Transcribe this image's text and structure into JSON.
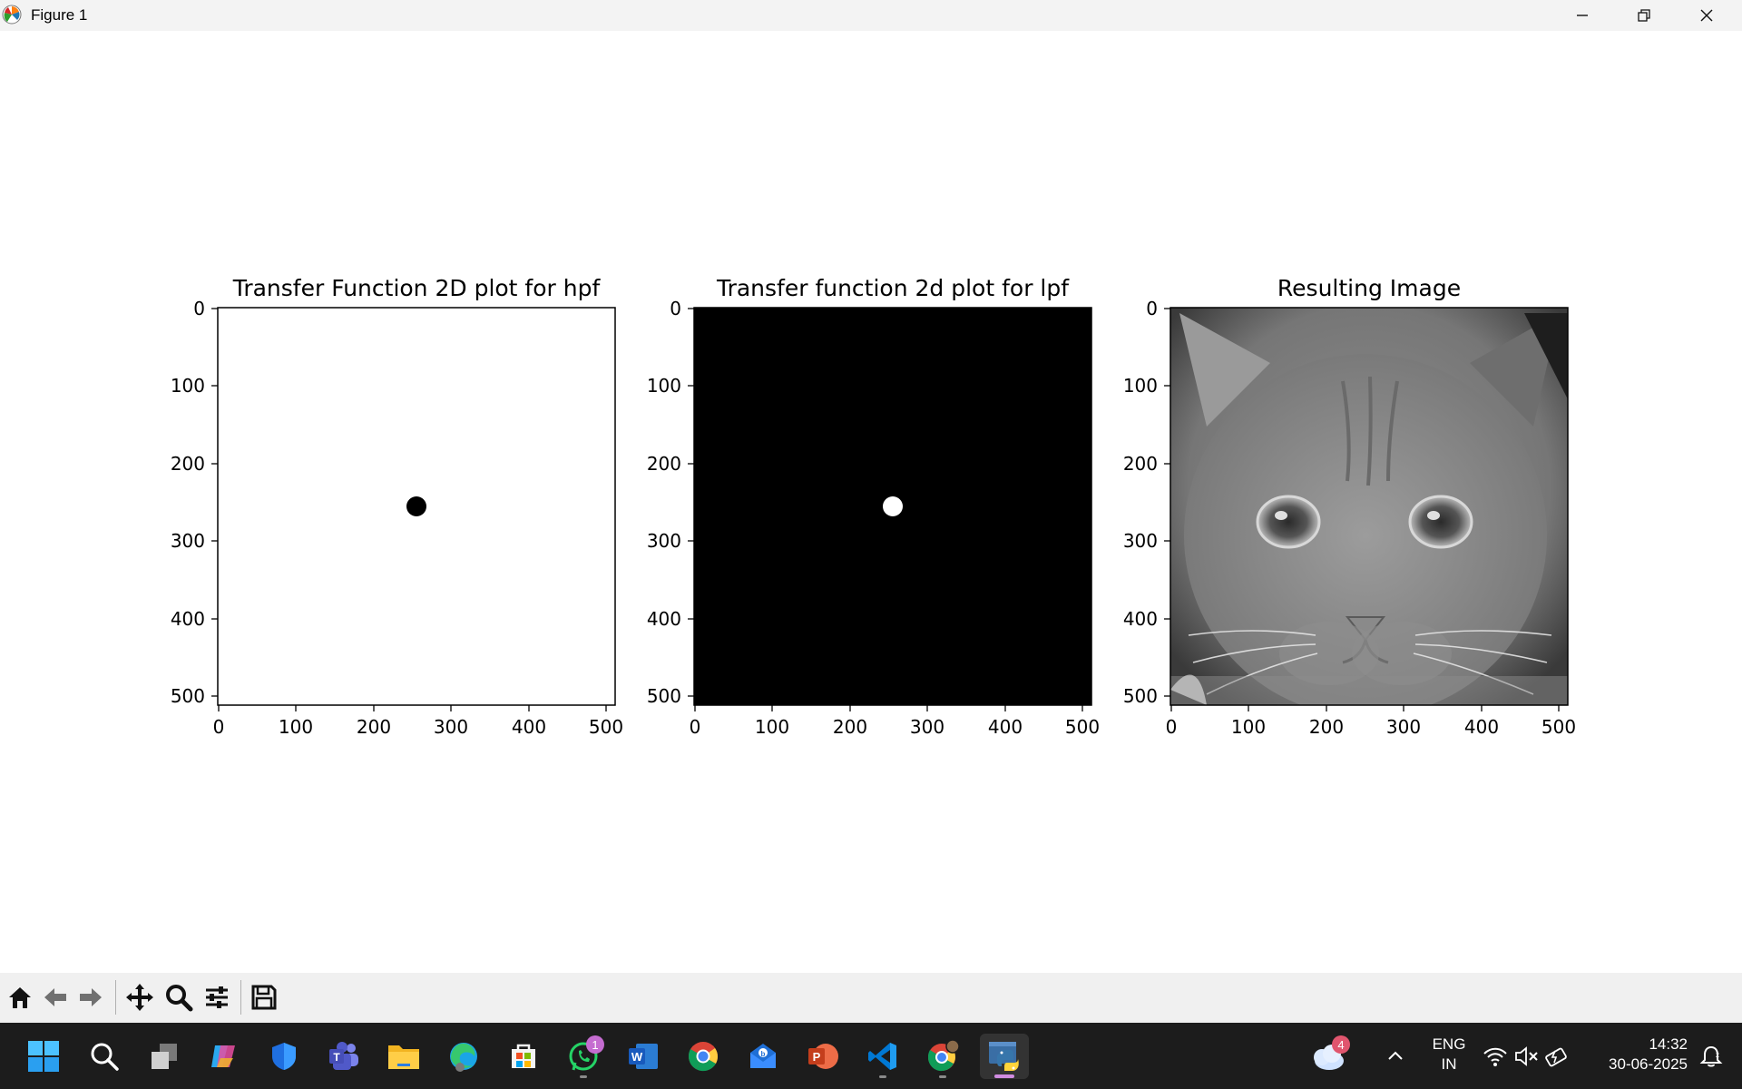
{
  "window": {
    "title": "Figure 1",
    "icons": [
      "matplotlib-icon",
      "minimize-icon",
      "restore-icon",
      "close-icon"
    ]
  },
  "figure": {
    "panels": [
      {
        "title": "Transfer Function 2D plot for hpf",
        "content": "white field with small black disk at center",
        "background": "#ffffff",
        "disk_color": "#000000",
        "x_ticks": [
          "0",
          "100",
          "200",
          "300",
          "400",
          "500"
        ],
        "y_ticks": [
          "0",
          "100",
          "200",
          "300",
          "400",
          "500"
        ]
      },
      {
        "title": "Transfer function 2d plot for lpf",
        "content": "black field with small white disk at center",
        "background": "#000000",
        "disk_color": "#ffffff",
        "x_ticks": [
          "0",
          "100",
          "200",
          "300",
          "400",
          "500"
        ],
        "y_ticks": [
          "0",
          "100",
          "200",
          "300",
          "400",
          "500"
        ]
      },
      {
        "title": "Resulting Image",
        "content": "grayscale filtered photo of a kitten",
        "x_ticks": [
          "0",
          "100",
          "200",
          "300",
          "400",
          "500"
        ],
        "y_ticks": [
          "0",
          "100",
          "200",
          "300",
          "400",
          "500"
        ]
      }
    ]
  },
  "toolbar": {
    "icons": [
      "home-icon",
      "back-icon",
      "forward-icon",
      "pan-icon",
      "zoom-icon",
      "configure-subplots-icon",
      "save-icon"
    ]
  },
  "taskbar": {
    "apps": [
      {
        "name": "start",
        "icon": "windows-start-icon"
      },
      {
        "name": "search",
        "icon": "search-icon"
      },
      {
        "name": "task-view",
        "icon": "task-view-icon"
      },
      {
        "name": "copilot",
        "icon": "copilot-icon"
      },
      {
        "name": "defender",
        "icon": "shield-icon"
      },
      {
        "name": "teams",
        "icon": "teams-icon"
      },
      {
        "name": "file-explorer",
        "icon": "folder-icon"
      },
      {
        "name": "edge",
        "icon": "edge-icon"
      },
      {
        "name": "store",
        "icon": "store-icon"
      },
      {
        "name": "whatsapp",
        "icon": "whatsapp-icon",
        "badge": "1"
      },
      {
        "name": "word",
        "icon": "word-icon"
      },
      {
        "name": "chrome",
        "icon": "chrome-icon"
      },
      {
        "name": "mail",
        "icon": "mail-icon"
      },
      {
        "name": "powerpoint",
        "icon": "powerpoint-icon"
      },
      {
        "name": "vscode",
        "icon": "vscode-icon"
      },
      {
        "name": "chrome-profile",
        "icon": "chrome-profile-icon"
      },
      {
        "name": "python",
        "icon": "python-icon"
      }
    ],
    "weather_badge": "4",
    "language": "ENG",
    "region": "IN",
    "time": "14:32",
    "date": "30-06-2025",
    "tray_icons": [
      "chevron-up-icon",
      "wifi-icon",
      "speaker-muted-icon",
      "battery-charging-icon",
      "notifications-icon"
    ]
  }
}
